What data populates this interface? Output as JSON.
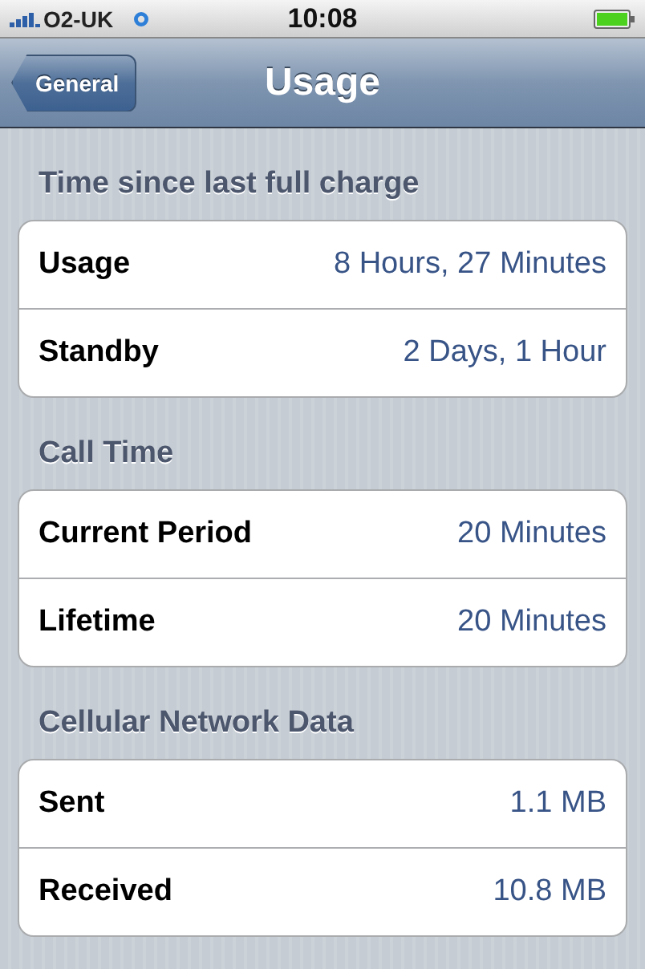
{
  "status_bar": {
    "carrier": "O2-UK",
    "time": "10:08"
  },
  "nav_bar": {
    "back_button": "General",
    "title": "Usage"
  },
  "sections": [
    {
      "header": "Time since last full charge",
      "rows": [
        {
          "label": "Usage",
          "value": "8 Hours, 27 Minutes"
        },
        {
          "label": "Standby",
          "value": "2 Days, 1 Hour"
        }
      ]
    },
    {
      "header": "Call Time",
      "rows": [
        {
          "label": "Current Period",
          "value": "20 Minutes"
        },
        {
          "label": "Lifetime",
          "value": "20 Minutes"
        }
      ]
    },
    {
      "header": "Cellular Network Data",
      "rows": [
        {
          "label": "Sent",
          "value": "1.1 MB"
        },
        {
          "label": "Received",
          "value": "10.8 MB"
        }
      ]
    }
  ]
}
